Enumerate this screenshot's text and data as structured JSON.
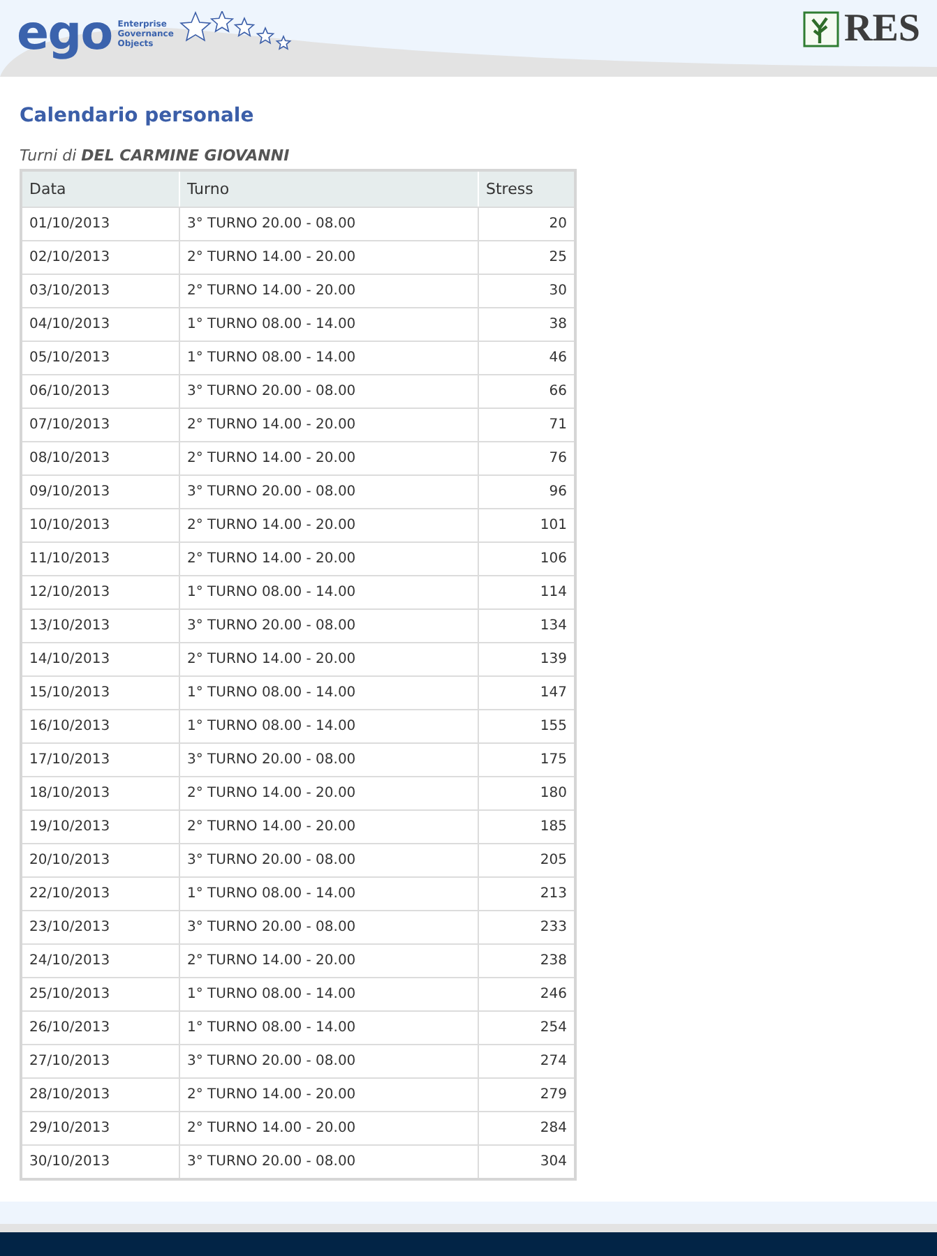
{
  "header": {
    "logo_text": "ego",
    "logo_tagline": [
      "Enterprise",
      "Governance",
      "Objects"
    ],
    "brand": "RES"
  },
  "title": "Calendario personale",
  "subtitle": "Turni di **DEL CARMINE GIOVANNI**",
  "table": {
    "columns": [
      "Data",
      "Turno",
      "Stress"
    ],
    "rows": [
      [
        "01/10/2013",
        "3° TURNO 20.00 - 08.00",
        "20"
      ],
      [
        "02/10/2013",
        "2° TURNO 14.00 - 20.00",
        "25"
      ],
      [
        "03/10/2013",
        "2° TURNO 14.00 - 20.00",
        "30"
      ],
      [
        "04/10/2013",
        "1° TURNO 08.00 - 14.00",
        "38"
      ],
      [
        "05/10/2013",
        "1° TURNO 08.00 - 14.00",
        "46"
      ],
      [
        "06/10/2013",
        "3° TURNO 20.00 - 08.00",
        "66"
      ],
      [
        "07/10/2013",
        "2° TURNO 14.00 - 20.00",
        "71"
      ],
      [
        "08/10/2013",
        "2° TURNO 14.00 - 20.00",
        "76"
      ],
      [
        "09/10/2013",
        "3° TURNO 20.00 - 08.00",
        "96"
      ],
      [
        "10/10/2013",
        "2° TURNO 14.00 - 20.00",
        "101"
      ],
      [
        "11/10/2013",
        "2° TURNO 14.00 - 20.00",
        "106"
      ],
      [
        "12/10/2013",
        "1° TURNO 08.00 - 14.00",
        "114"
      ],
      [
        "13/10/2013",
        "3° TURNO 20.00 - 08.00",
        "134"
      ],
      [
        "14/10/2013",
        "2° TURNO 14.00 - 20.00",
        "139"
      ],
      [
        "15/10/2013",
        "1° TURNO 08.00 - 14.00",
        "147"
      ],
      [
        "16/10/2013",
        "1° TURNO 08.00 - 14.00",
        "155"
      ],
      [
        "17/10/2013",
        "3° TURNO 20.00 - 08.00",
        "175"
      ],
      [
        "18/10/2013",
        "2° TURNO 14.00 - 20.00",
        "180"
      ],
      [
        "19/10/2013",
        "2° TURNO 14.00 - 20.00",
        "185"
      ],
      [
        "20/10/2013",
        "3° TURNO 20.00 - 08.00",
        "205"
      ],
      [
        "22/10/2013",
        "1° TURNO 08.00 - 14.00",
        "213"
      ],
      [
        "23/10/2013",
        "3° TURNO 20.00 - 08.00",
        "233"
      ],
      [
        "24/10/2013",
        "2° TURNO 14.00 - 20.00",
        "238"
      ],
      [
        "25/10/2013",
        "1° TURNO 08.00 - 14.00",
        "246"
      ],
      [
        "26/10/2013",
        "1° TURNO 08.00 - 14.00",
        "254"
      ],
      [
        "27/10/2013",
        "3° TURNO 20.00 - 08.00",
        "274"
      ],
      [
        "28/10/2013",
        "2° TURNO 14.00 - 20.00",
        "279"
      ],
      [
        "29/10/2013",
        "2° TURNO 14.00 - 20.00",
        "284"
      ],
      [
        "30/10/2013",
        "3° TURNO 20.00 - 08.00",
        "304"
      ]
    ]
  }
}
